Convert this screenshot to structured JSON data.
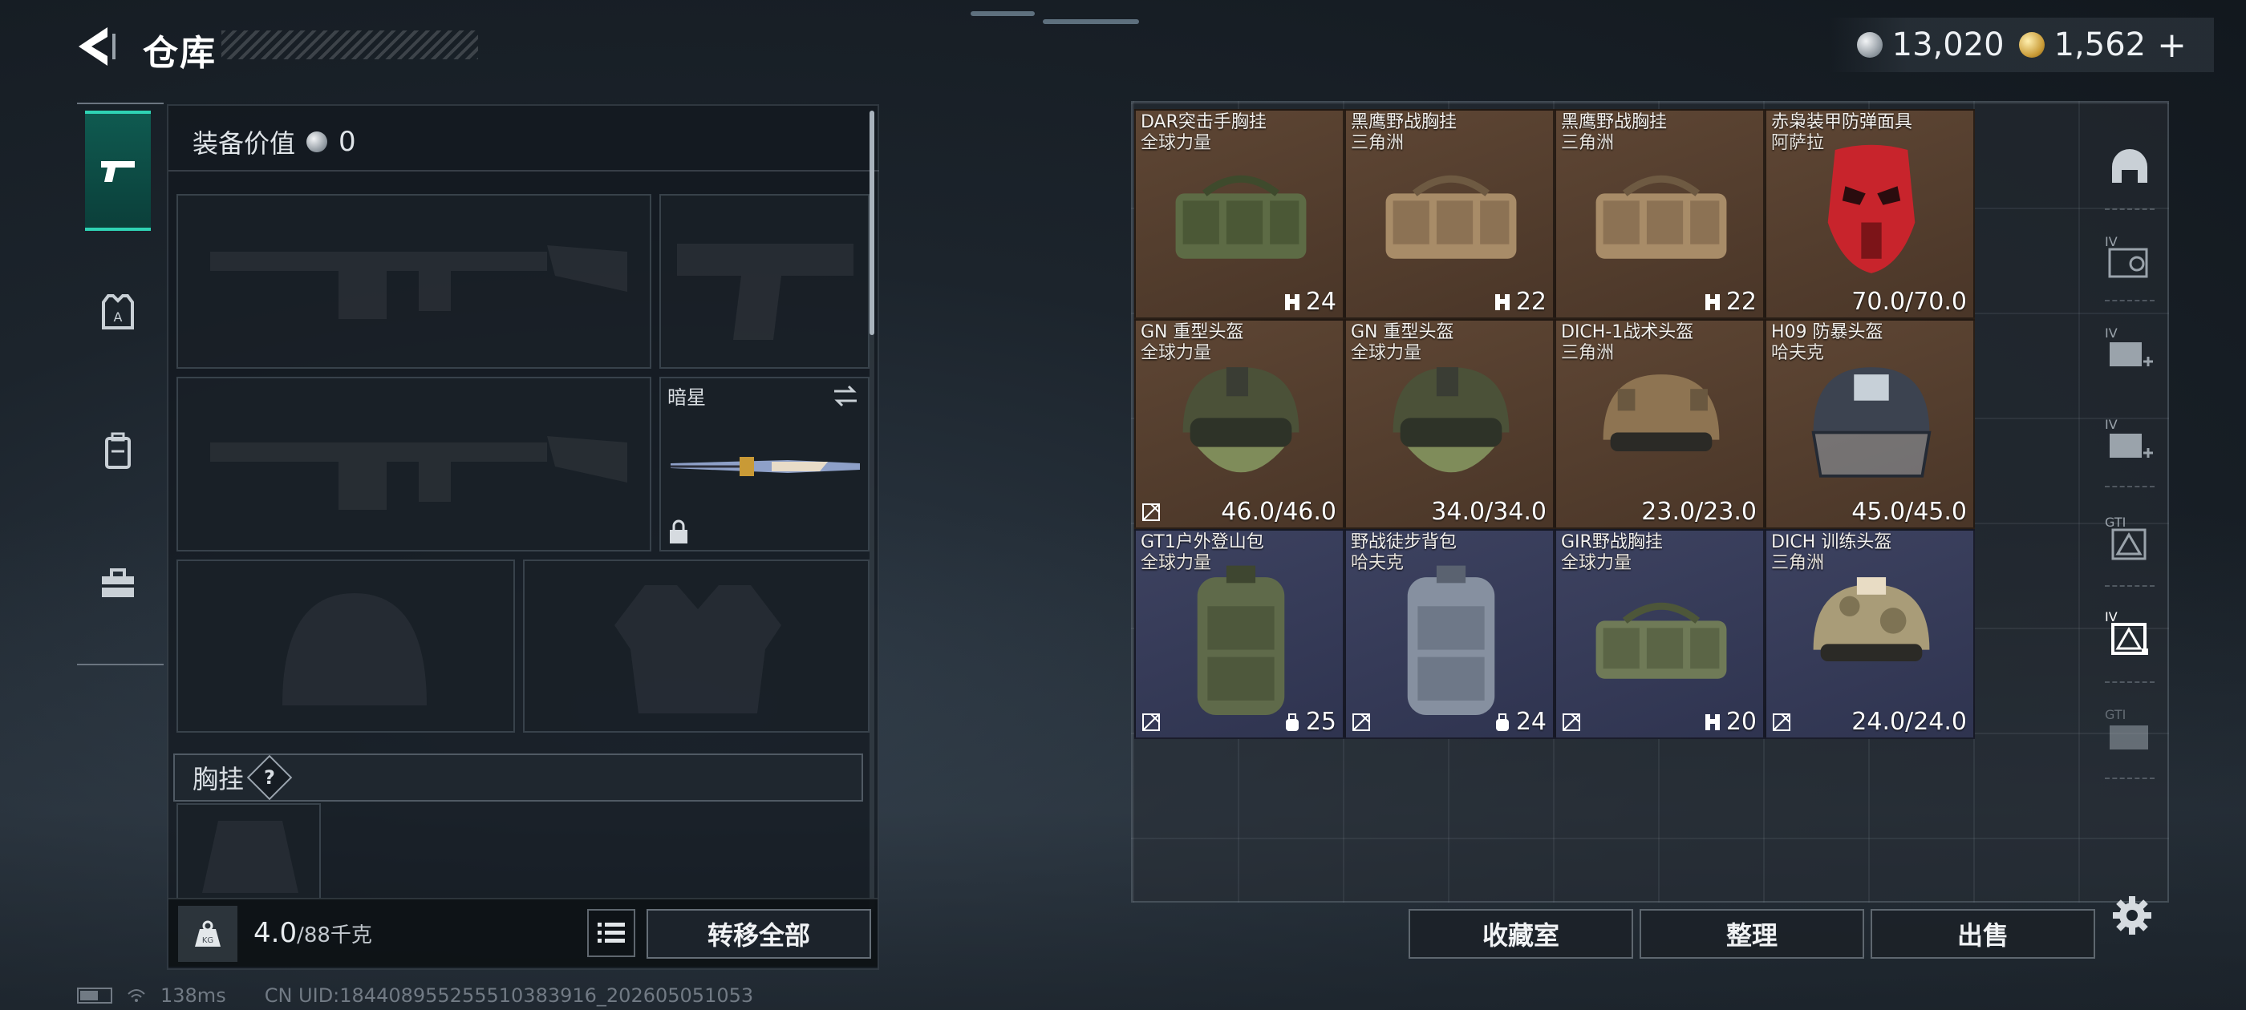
{
  "header": {
    "title": "仓库",
    "silver_amount": "13,020",
    "gold_amount": "1,562",
    "plus_label": "+"
  },
  "side_tabs": [
    {
      "name": "weapons",
      "icon": "pistol-icon",
      "active": true
    },
    {
      "name": "armor",
      "icon": "armor-vest-icon",
      "active": false
    },
    {
      "name": "backpack",
      "icon": "backpack-icon",
      "active": false
    },
    {
      "name": "kit",
      "icon": "toolbox-icon",
      "active": false
    }
  ],
  "loadout": {
    "equip_value_label": "装备价值",
    "equip_value": "0",
    "melee_slot_label": "暗星",
    "chest_rig_label": "胸挂",
    "help_label": "?",
    "weight_current": "4.0",
    "weight_capacity": "/88千克",
    "transfer_all_label": "转移全部"
  },
  "stash": {
    "items": [
      {
        "name": "DAR突击手胸挂",
        "sub": "全球力量",
        "stat": "24",
        "stat_icon": "capacity-icon",
        "bg": "brown",
        "art": "chest-rig-green"
      },
      {
        "name": "黑鹰野战胸挂",
        "sub": "三角洲",
        "stat": "22",
        "stat_icon": "capacity-icon",
        "bg": "brown",
        "art": "chest-rig-tan"
      },
      {
        "name": "黑鹰野战胸挂",
        "sub": "三角洲",
        "stat": "22",
        "stat_icon": "capacity-icon",
        "bg": "brown",
        "art": "chest-rig-tan"
      },
      {
        "name": "赤枭装甲防弹面具",
        "sub": "阿萨拉",
        "stat": "70.0/70.0",
        "stat_icon": "",
        "bg": "brown",
        "art": "red-mask"
      },
      {
        "name": "GN 重型头盔",
        "sub": "全球力量",
        "stat": "46.0/46.0",
        "stat_icon": "",
        "bg": "brown",
        "art": "helmet-green-visor",
        "flag": true
      },
      {
        "name": "GN 重型头盔",
        "sub": "全球力量",
        "stat": "34.0/34.0",
        "stat_icon": "",
        "bg": "brown",
        "art": "helmet-green-visor"
      },
      {
        "name": "DICH-1战术头盔",
        "sub": "三角洲",
        "stat": "23.0/23.0",
        "stat_icon": "",
        "bg": "brown",
        "art": "helmet-tan"
      },
      {
        "name": "H09 防暴头盔",
        "sub": "哈夫克",
        "stat": "45.0/45.0",
        "stat_icon": "",
        "bg": "brown",
        "art": "helmet-riot"
      },
      {
        "name": "GT1户外登山包",
        "sub": "全球力量",
        "stat": "25",
        "stat_icon": "bag-icon",
        "bg": "blue",
        "art": "backpack-green",
        "flag": true
      },
      {
        "name": "野战徒步背包",
        "sub": "哈夫克",
        "stat": "24",
        "stat_icon": "bag-icon",
        "bg": "blue",
        "art": "backpack-grey",
        "flag": true
      },
      {
        "name": "GIR野战胸挂",
        "sub": "全球力量",
        "stat": "20",
        "stat_icon": "capacity-icon",
        "bg": "blue",
        "art": "chest-rig-olive",
        "flag": true
      },
      {
        "name": "DICH 训练头盔",
        "sub": "三角洲",
        "stat": "24.0/24.0",
        "stat_icon": "",
        "bg": "blue",
        "art": "helmet-camo",
        "flag": true
      }
    ]
  },
  "filters": [
    {
      "icon": "helmet-filter-icon",
      "label": ""
    },
    {
      "icon": "chest-rig-iv-icon",
      "label": "IV"
    },
    {
      "icon": "medkit-iv-icon",
      "label": "IV"
    },
    {
      "icon": "medkit-iv-2-icon",
      "label": "IV"
    },
    {
      "icon": "rig-gti-icon",
      "label": "GTI"
    },
    {
      "icon": "rig-iv-active-icon",
      "label": "IV"
    },
    {
      "icon": "bag-gti-icon",
      "label": "GTI"
    }
  ],
  "actions": {
    "collection_label": "收藏室",
    "sort_label": "整理",
    "sell_label": "出售"
  },
  "status": {
    "ping": "138ms",
    "uid": "CN UID:18440895525551038391​6_202605051053"
  },
  "colors": {
    "accent": "#2fd3b4",
    "item_brown": "#5e4634",
    "item_blue": "#3d4260"
  }
}
